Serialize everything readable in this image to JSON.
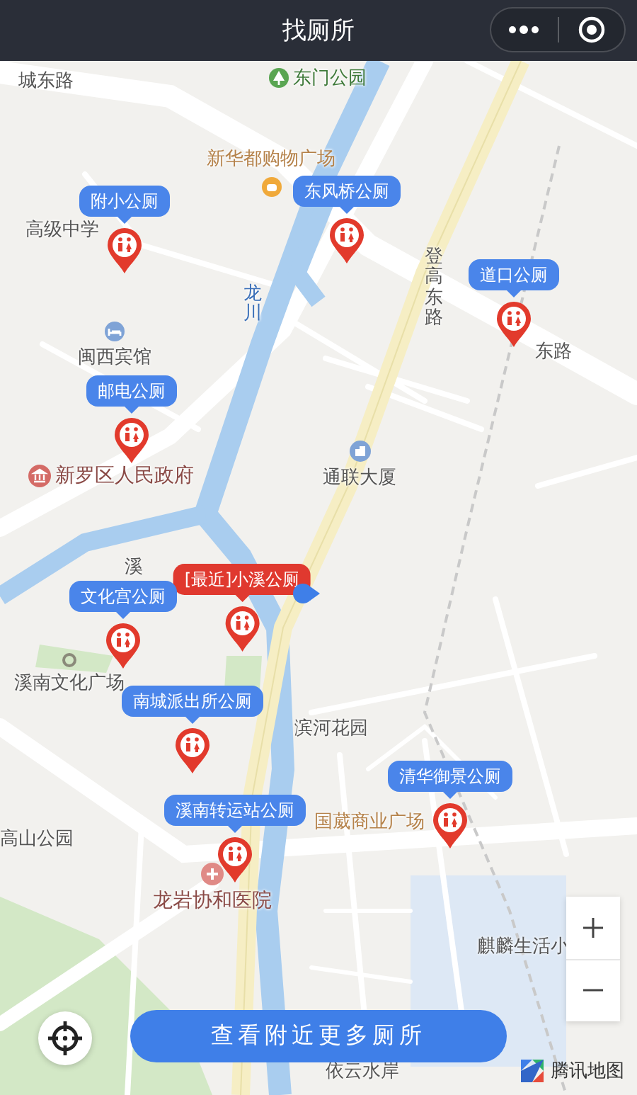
{
  "header": {
    "title": "找厕所"
  },
  "places": [
    {
      "name": "城东路",
      "kind": "road"
    },
    {
      "name": "东门公园",
      "kind": "park"
    },
    {
      "name": "新华都购物广场",
      "kind": "shop"
    },
    {
      "name": "高级中学",
      "kind": "area"
    },
    {
      "name": "龙川",
      "kind": "river"
    },
    {
      "name": "登高东路",
      "kind": "road"
    },
    {
      "name": "闽西宾馆",
      "kind": "hotel"
    },
    {
      "name": "东路",
      "kind": "road"
    },
    {
      "name": "新罗区人民政府",
      "kind": "government"
    },
    {
      "name": "通联大厦",
      "kind": "building"
    },
    {
      "name": "溪",
      "kind": "road"
    },
    {
      "name": "溪南文化广场",
      "kind": "square"
    },
    {
      "name": "滨河花园",
      "kind": "area"
    },
    {
      "name": "高山公园",
      "kind": "area"
    },
    {
      "name": "国葳商业广场",
      "kind": "mall"
    },
    {
      "name": "龙岩协和医院",
      "kind": "hospital"
    },
    {
      "name": "麒麟生活小",
      "kind": "area"
    },
    {
      "name": "依云水岸",
      "kind": "area"
    }
  ],
  "toilets": [
    {
      "label": "附小公厕",
      "nearest": false
    },
    {
      "label": "东风桥公厕",
      "nearest": false
    },
    {
      "label": "道口公厕",
      "nearest": false
    },
    {
      "label": "邮电公厕",
      "nearest": false
    },
    {
      "label": "[最近]小溪公厕",
      "nearest": true
    },
    {
      "label": "文化宫公厕",
      "nearest": false
    },
    {
      "label": "南城派出所公厕",
      "nearest": false
    },
    {
      "label": "溪南转运站公厕",
      "nearest": false
    },
    {
      "label": "清华御景公厕",
      "nearest": false
    }
  ],
  "more_button": "查看附近更多厕所",
  "map_logo": "腾讯地图"
}
